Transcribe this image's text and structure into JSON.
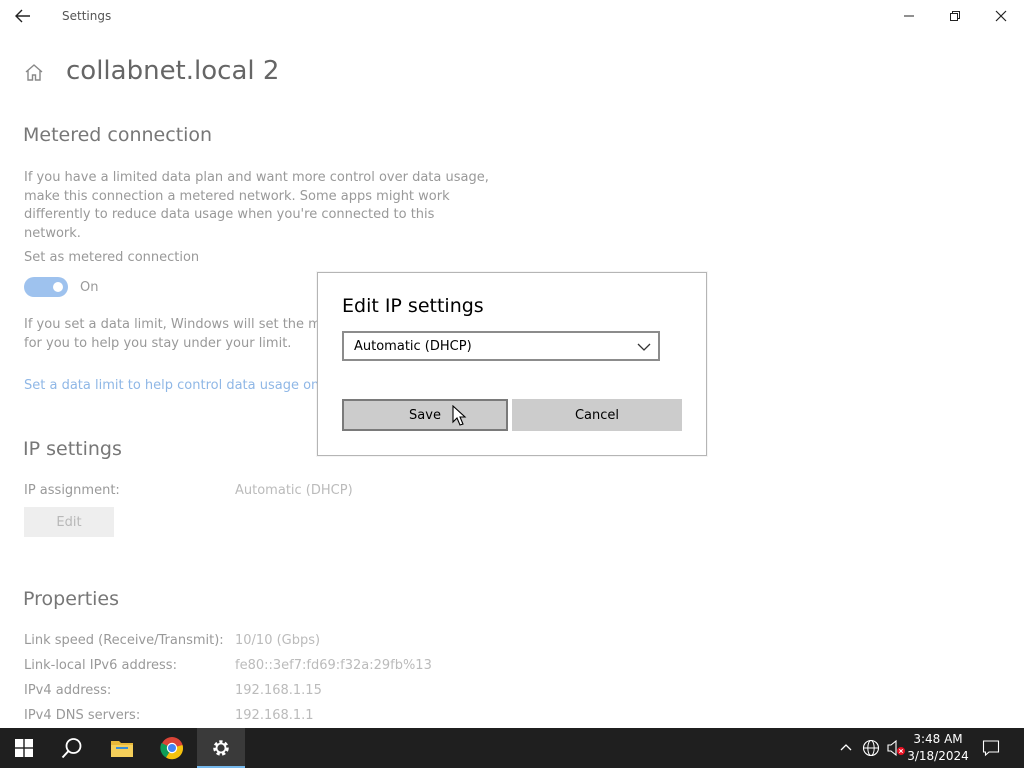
{
  "window": {
    "title": "Settings"
  },
  "page": {
    "title": "collabnet.local 2"
  },
  "metered": {
    "heading": "Metered connection",
    "description_lines": [
      "If you have a limited data plan and want more control over data usage,",
      "make this connection a metered network. Some apps might work",
      "differently to reduce data usage when you're connected to this network."
    ],
    "toggle_label": "Set as metered connection",
    "toggle_state": "On",
    "data_limit_lines": [
      "If you set a data limit, Windows will set the mete",
      "for you to help you stay under your limit."
    ],
    "data_limit_link": "Set a data limit to help control data usage on th"
  },
  "ip_settings": {
    "heading": "IP settings",
    "assignment_label": "IP assignment:",
    "assignment_value": "Automatic (DHCP)",
    "edit_label": "Edit"
  },
  "properties": {
    "heading": "Properties",
    "rows": [
      {
        "label": "Link speed (Receive/Transmit):",
        "value": "10/10 (Gbps)"
      },
      {
        "label": "Link-local IPv6 address:",
        "value": "fe80::3ef7:fd69:f32a:29fb%13"
      },
      {
        "label": "IPv4 address:",
        "value": "192.168.1.15"
      },
      {
        "label": "IPv4 DNS servers:",
        "value": "192.168.1.1"
      }
    ]
  },
  "dialog": {
    "title": "Edit IP settings",
    "selected_option": "Automatic (DHCP)",
    "save_label": "Save",
    "cancel_label": "Cancel"
  },
  "taskbar": {
    "items": [
      "windows-start-icon",
      "search-icon",
      "file-explorer-icon",
      "chrome-icon",
      "settings-icon"
    ],
    "tray": {
      "time": "3:48 AM",
      "date": "3/18/2024"
    }
  },
  "colors": {
    "accent": "#0078d7",
    "link": "#8fb7e6",
    "taskbar": "#1f1f1f"
  }
}
